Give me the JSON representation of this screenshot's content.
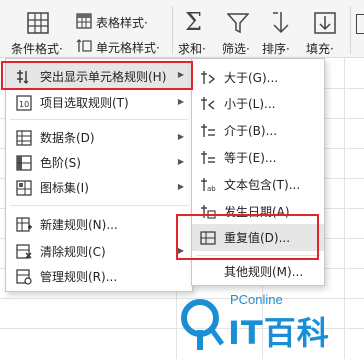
{
  "ribbon": {
    "conditional_format_label": "条件格式·",
    "table_style_label": "表格样式·",
    "cell_style_label": "单元格样式·",
    "sum_label": "求和·",
    "filter_label": "筛选·",
    "sort_label": "排序·",
    "fill_label": "填充·"
  },
  "main_menu": {
    "items": [
      {
        "label": "突出显示单元格规则(H)",
        "icon": "highlight-rules-icon",
        "has_submenu": true,
        "selected": true
      },
      {
        "label": "项目选取规则(T)",
        "icon": "top-bottom-rules-icon",
        "has_submenu": true
      },
      {
        "label": "数据条(D)",
        "icon": "data-bars-icon",
        "has_submenu": true
      },
      {
        "label": "色阶(S)",
        "icon": "color-scales-icon",
        "has_submenu": true
      },
      {
        "label": "图标集(I)",
        "icon": "icon-sets-icon",
        "has_submenu": true
      },
      {
        "label": "新建规则(N)...",
        "icon": "new-rule-icon"
      },
      {
        "label": "清除规则(C)",
        "icon": "clear-rules-icon",
        "has_submenu": true
      },
      {
        "label": "管理规则(R)...",
        "icon": "manage-rules-icon"
      }
    ]
  },
  "sub_menu": {
    "items": [
      {
        "label": "大于(G)...",
        "icon": "greater-than-icon"
      },
      {
        "label": "小于(L)...",
        "icon": "less-than-icon"
      },
      {
        "label": "介于(B)...",
        "icon": "between-icon"
      },
      {
        "label": "等于(E)...",
        "icon": "equal-to-icon"
      },
      {
        "label": "文本包含(T)...",
        "icon": "text-contains-icon"
      },
      {
        "label": "发生日期(A)...",
        "icon": "date-occurring-icon"
      },
      {
        "label": "重复值(D)...",
        "icon": "duplicate-values-icon",
        "selected": true
      },
      {
        "label": "其他规则(M)...",
        "icon": ""
      }
    ]
  },
  "watermark": {
    "brand_small": "PConline",
    "brand_large": "IT百科"
  },
  "colors": {
    "highlight_border": "#e0262b",
    "selected_row": "#e6e6e6",
    "watermark_blue": "#1a8fd6"
  }
}
